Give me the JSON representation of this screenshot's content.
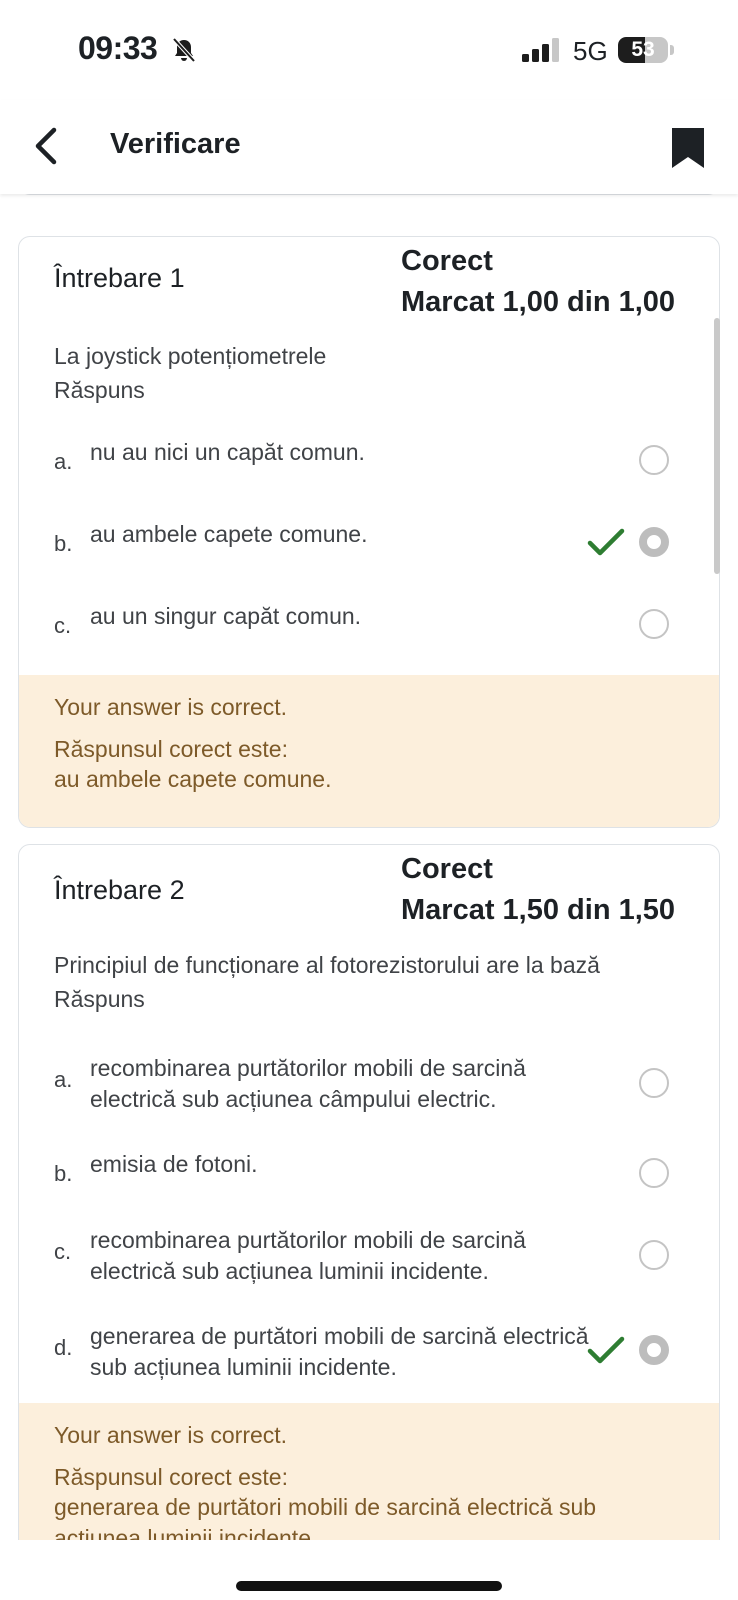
{
  "status_bar": {
    "time": "09:33",
    "network": "5G",
    "battery_percent": 53,
    "battery_label": "53"
  },
  "app_bar": {
    "title": "Verificare"
  },
  "questions": [
    {
      "title": "Întrebare 1",
      "state": "Corect",
      "mark": "Marcat 1,00 din 1,00",
      "text": "La joystick potențiometrele",
      "answer_label": "Răspuns",
      "options": [
        {
          "letter": "a.",
          "text": "nu au nici un capăt comun.",
          "selected": false
        },
        {
          "letter": "b.",
          "text": "au ambele capete comune.",
          "selected": true
        },
        {
          "letter": "c.",
          "text": "au un singur capăt comun.",
          "selected": false
        }
      ],
      "feedback": {
        "status": "Your answer is correct.",
        "right_answer_label": "Răspunsul corect este:",
        "right_answer": "au ambele capete comune."
      }
    },
    {
      "title": "Întrebare 2",
      "state": "Corect",
      "mark": "Marcat 1,50 din 1,50",
      "text": "Principiul de funcționare al fotorezistorului are la bază",
      "answer_label": "Răspuns",
      "options": [
        {
          "letter": "a.",
          "text": "recombinarea purtătorilor mobili de sarcină electrică sub acțiunea câmpului electric.",
          "selected": false
        },
        {
          "letter": "b.",
          "text": "emisia de fotoni.",
          "selected": false
        },
        {
          "letter": "c.",
          "text": "recombinarea purtătorilor mobili de sarcină electrică sub acțiunea luminii incidente.",
          "selected": false
        },
        {
          "letter": "d.",
          "text": "generarea de purtători mobili de sarcină electrică  sub acțiunea luminii incidente.",
          "selected": true
        }
      ],
      "feedback": {
        "status": "Your answer is correct.",
        "right_answer_label": "Răspunsul corect este:",
        "right_answer": "generarea de purtători mobili de sarcină electrică  sub acțiunea luminii incidente."
      }
    }
  ],
  "colors": {
    "feedback_bg": "#fcefdc",
    "feedback_text": "#7d5a29",
    "check_green": "#2e7d32"
  },
  "icons": {
    "back": "chevron-left-icon",
    "bookmark": "bookmark-icon",
    "mute": "bell-slash-icon",
    "check": "check-icon"
  }
}
